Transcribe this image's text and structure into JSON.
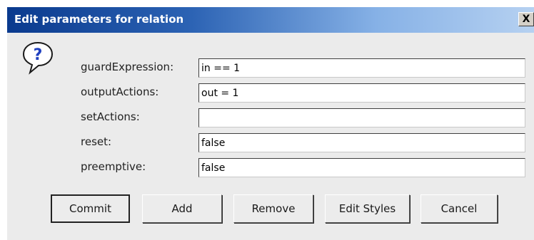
{
  "window": {
    "title": "Edit parameters for relation",
    "close_label": "X"
  },
  "icons": {
    "dialog_icon": "question-icon"
  },
  "colors": {
    "titlebar_start": "#0a3a8e",
    "titlebar_end": "#b6d1f1",
    "panel_bg": "#ebebeb",
    "icon_blue": "#1f3fbf"
  },
  "fields": [
    {
      "label": "guardExpression:",
      "value": "in == 1"
    },
    {
      "label": "outputActions:",
      "value": "out = 1"
    },
    {
      "label": "setActions:",
      "value": ""
    },
    {
      "label": "reset:",
      "value": "false"
    },
    {
      "label": "preemptive:",
      "value": "false"
    }
  ],
  "buttons": {
    "commit": "Commit",
    "add": "Add",
    "remove": "Remove",
    "edit_styles": "Edit Styles",
    "cancel": "Cancel"
  }
}
